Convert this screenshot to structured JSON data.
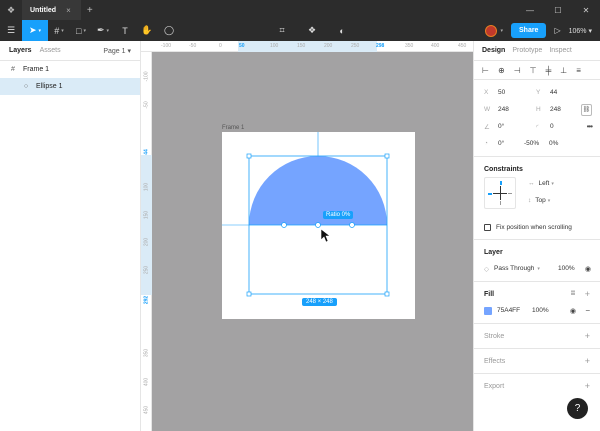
{
  "titlebar": {
    "tab_title": "Untitled",
    "tab_close": "×",
    "new_tab": "+"
  },
  "toolbar": {
    "share_label": "Share",
    "zoom": "106%"
  },
  "left_panel": {
    "tabs": [
      "Layers",
      "Assets"
    ],
    "page": "Page 1",
    "layers": [
      {
        "name": "Frame 1",
        "icon": "frame-icon"
      },
      {
        "name": "Ellipse 1",
        "icon": "ellipse-icon",
        "selected": true
      }
    ]
  },
  "rulers": {
    "top": [
      "-100",
      "-50",
      "0",
      "50",
      "100",
      "150",
      "200",
      "250",
      "298",
      "350",
      "400",
      "450"
    ],
    "top_highlight": [
      "50",
      "298"
    ],
    "left": [
      "-100",
      "-50",
      "44",
      "100",
      "150",
      "200",
      "250",
      "292",
      "350",
      "400",
      "450"
    ],
    "left_highlight": [
      "44",
      "292"
    ]
  },
  "canvas": {
    "frame_label": "Frame 1",
    "ratio_label": "Ratio 0%",
    "size_label": "248 × 248",
    "fill_color": "#75a4ff",
    "selection_color": "#18a0fb"
  },
  "right_panel": {
    "tabs": [
      "Design",
      "Prototype",
      "Inspect"
    ],
    "x": {
      "label": "X",
      "value": "50"
    },
    "y": {
      "label": "Y",
      "value": "44"
    },
    "w": {
      "label": "W",
      "value": "248"
    },
    "h": {
      "label": "H",
      "value": "248"
    },
    "rotation": "0°",
    "corner_radius": "0",
    "arc_start": "0°",
    "arc_sweep": "-50%",
    "arc_ratio": "0%",
    "constraints": {
      "title": "Constraints",
      "horizontal": "Left",
      "vertical": "Top"
    },
    "fix_position_label": "Fix position when scrolling",
    "layer": {
      "title": "Layer",
      "blend": "Pass Through",
      "opacity": "100%"
    },
    "fill": {
      "title": "Fill",
      "hex": "75A4FF",
      "opacity": "100%",
      "color": "#75a4ff"
    },
    "stroke_title": "Stroke",
    "effects_title": "Effects",
    "export_title": "Export"
  },
  "help_label": "?"
}
